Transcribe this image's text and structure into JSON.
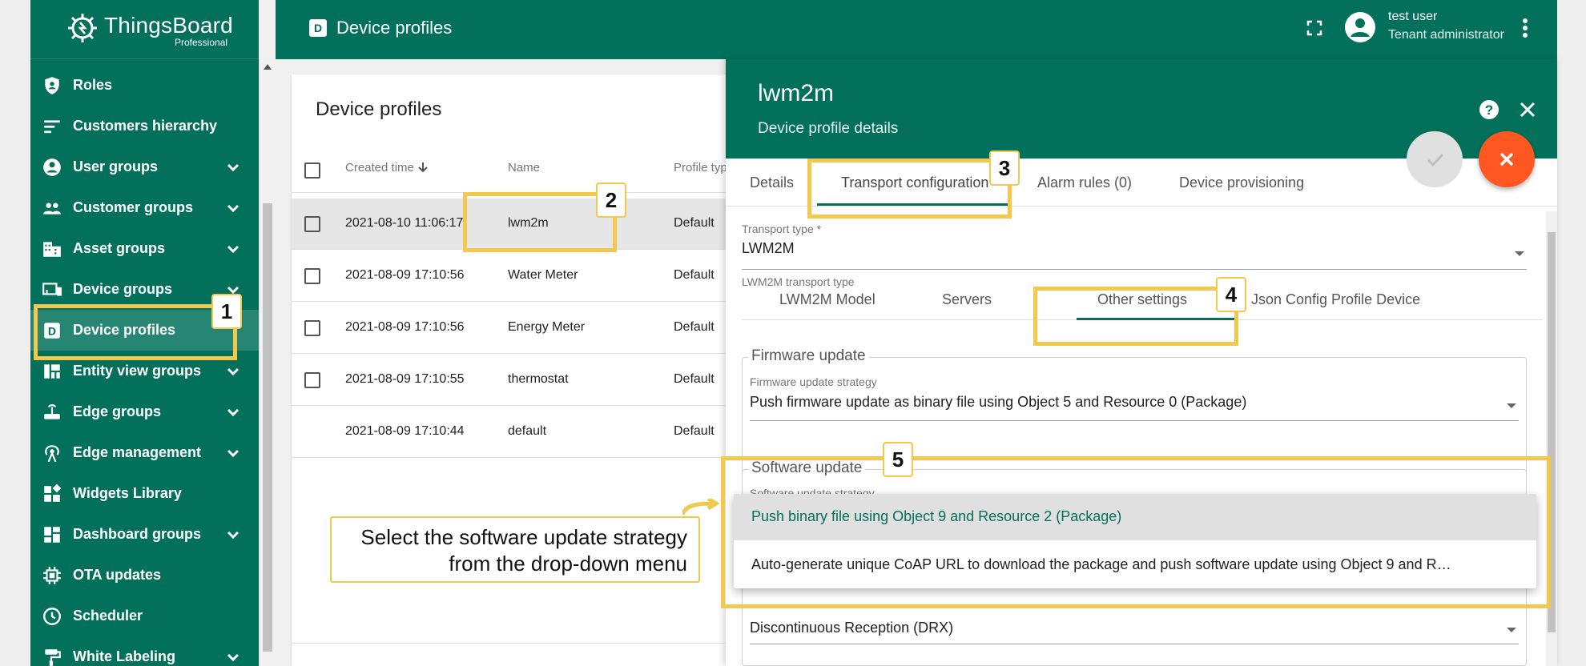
{
  "app": {
    "logo_name": "ThingsBoard",
    "logo_sub": "Professional",
    "page_title": "Device profiles",
    "page_icon": "D",
    "user_name": "test user",
    "user_role": "Tenant administrator"
  },
  "sidebar": {
    "items": [
      {
        "label": "Roles",
        "icon": "shield-icon",
        "chevron": false
      },
      {
        "label": "Customers hierarchy",
        "icon": "hierarchy-icon",
        "chevron": false
      },
      {
        "label": "User groups",
        "icon": "account-circle-icon",
        "chevron": true
      },
      {
        "label": "Customer groups",
        "icon": "people-icon",
        "chevron": true
      },
      {
        "label": "Asset groups",
        "icon": "domain-icon",
        "chevron": true
      },
      {
        "label": "Device groups",
        "icon": "devices-icon",
        "chevron": true
      },
      {
        "label": "Device profiles",
        "icon": "device-profile-icon",
        "chevron": false
      },
      {
        "label": "Entity view groups",
        "icon": "view-quilt-icon",
        "chevron": true
      },
      {
        "label": "Edge groups",
        "icon": "router-icon",
        "chevron": true
      },
      {
        "label": "Edge management",
        "icon": "antenna-icon",
        "chevron": true
      },
      {
        "label": "Widgets Library",
        "icon": "widgets-icon",
        "chevron": false
      },
      {
        "label": "Dashboard groups",
        "icon": "dashboard-icon",
        "chevron": true
      },
      {
        "label": "OTA updates",
        "icon": "memory-icon",
        "chevron": false
      },
      {
        "label": "Scheduler",
        "icon": "clock-icon",
        "chevron": false
      },
      {
        "label": "White Labeling",
        "icon": "format-paint-icon",
        "chevron": true
      }
    ]
  },
  "list": {
    "title": "Device profiles",
    "columns": {
      "created": "Created time",
      "name": "Name",
      "type": "Profile typ"
    },
    "rows": [
      {
        "created": "2021-08-10 11:06:17",
        "name": "lwm2m",
        "type": "Default"
      },
      {
        "created": "2021-08-09 17:10:56",
        "name": "Water Meter",
        "type": "Default"
      },
      {
        "created": "2021-08-09 17:10:56",
        "name": "Energy Meter",
        "type": "Default"
      },
      {
        "created": "2021-08-09 17:10:55",
        "name": "thermostat",
        "type": "Default"
      },
      {
        "created": "2021-08-09 17:10:44",
        "name": "default",
        "type": "Default"
      }
    ]
  },
  "panel": {
    "title": "lwm2m",
    "subtitle": "Device profile details",
    "tabs": [
      "Details",
      "Transport configuration",
      "Alarm rules (0)",
      "Device provisioning"
    ],
    "transport_type_label": "Transport type *",
    "transport_type_value": "LWM2M",
    "transport_type_hint": "LWM2M transport type",
    "subtabs": [
      "LWM2M Model",
      "Servers",
      "Other settings",
      "Json Config Profile Device"
    ],
    "firmware_legend": "Firmware update",
    "firmware_strategy_label": "Firmware update strategy",
    "firmware_strategy_value": "Push firmware update as binary file using Object 5 and Resource 0 (Package)",
    "software_legend": "Software update",
    "software_strategy_label": "Software update strategy",
    "power_mode_value": "Discontinuous Reception (DRX)",
    "dropdown_options": [
      "Push binary file using Object 9 and Resource 2 (Package)",
      "Auto-generate unique CoAP URL to download the package and push software update using Object 9 and R…"
    ]
  },
  "annotations": {
    "badges": [
      "1",
      "2",
      "3",
      "4",
      "5"
    ],
    "callout": "Select the software update strategy from the drop-down menu",
    "highlight_color": "#f2c94c"
  },
  "colors": {
    "primary": "#02705b",
    "accent": "#ff5722"
  }
}
